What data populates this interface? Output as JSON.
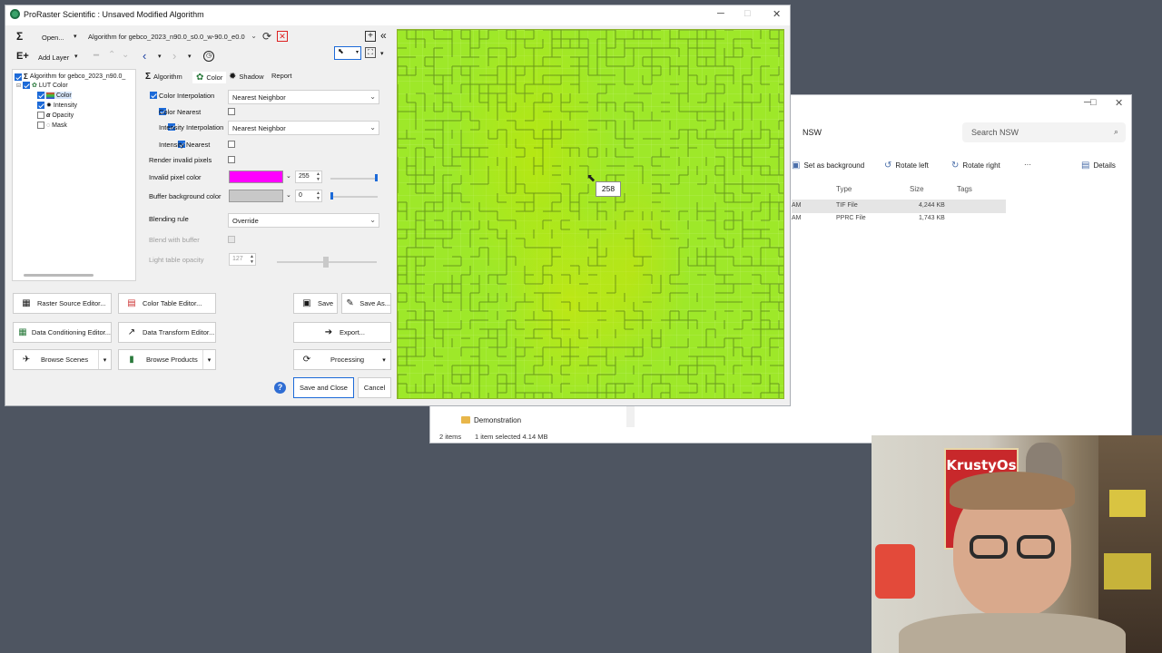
{
  "explorer": {
    "breadcrumb": "NSW",
    "search_placeholder": "Search NSW",
    "commands": [
      "Set as background",
      "Rotate left",
      "Rotate right",
      "···",
      "Details"
    ],
    "columns": [
      "Type",
      "Size",
      "Tags"
    ],
    "rows": [
      {
        "time": "AM",
        "type": "TIF File",
        "size": "4,244 KB"
      },
      {
        "time": "AM",
        "type": "PPRC File",
        "size": "1,743 KB"
      }
    ],
    "folder": "Demonstration",
    "status_items": "2 items",
    "status_selected": "1 item selected  4.14 MB"
  },
  "window": {
    "title": "ProRaster Scientific : Unsaved Modified Algorithm"
  },
  "toolbar": {
    "open_label": "Open...",
    "algorithm_combo": "Algorithm for gebco_2023_n90.0_s0.0_w-90.0_e0.0",
    "add_layer_label": "Add Layer"
  },
  "tree": {
    "root": "Algorithm for gebco_2023_n90.0_",
    "lut": "LUT Color",
    "items": [
      "Color",
      "Intensity",
      "Opacity",
      "Mask"
    ]
  },
  "tabs": [
    "Algorithm",
    "Color",
    "Shadow",
    "Report"
  ],
  "settings": {
    "color_interpolation": {
      "label": "Color Interpolation",
      "value": "Nearest Neighbor"
    },
    "color_nearest": "Color Nearest",
    "intensity_interpolation": {
      "label": "Intensity Interpolation",
      "value": "Nearest Neighbor"
    },
    "intensity_nearest": "Intensity Nearest",
    "render_invalid": "Render invalid pixels",
    "invalid_pixel_color": {
      "label": "Invalid pixel color",
      "value": "255",
      "color": "#ff00ff"
    },
    "buffer_background": {
      "label": "Buffer background color",
      "value": "0",
      "color": "#c8c8c8"
    },
    "blending_rule": {
      "label": "Blending rule",
      "value": "Override"
    },
    "blend_with_buffer": "Blend with buffer",
    "light_table_opacity": {
      "label": "Light table opacity",
      "value": "127"
    }
  },
  "buttons": {
    "raster_source": "Raster Source Editor...",
    "color_table": "Color Table Editor...",
    "data_conditioning": "Data Conditioning Editor...",
    "data_transform": "Data Transform Editor...",
    "browse_scenes": "Browse Scenes",
    "browse_products": "Browse Products",
    "save": "Save",
    "save_as": "Save As...",
    "export": "Export...",
    "processing": "Processing",
    "save_close": "Save and Close",
    "cancel": "Cancel"
  },
  "raster": {
    "tooltip_value": "258",
    "base_color": "#9ee829"
  },
  "webcam": {
    "poster_text": "KrustyOs"
  }
}
